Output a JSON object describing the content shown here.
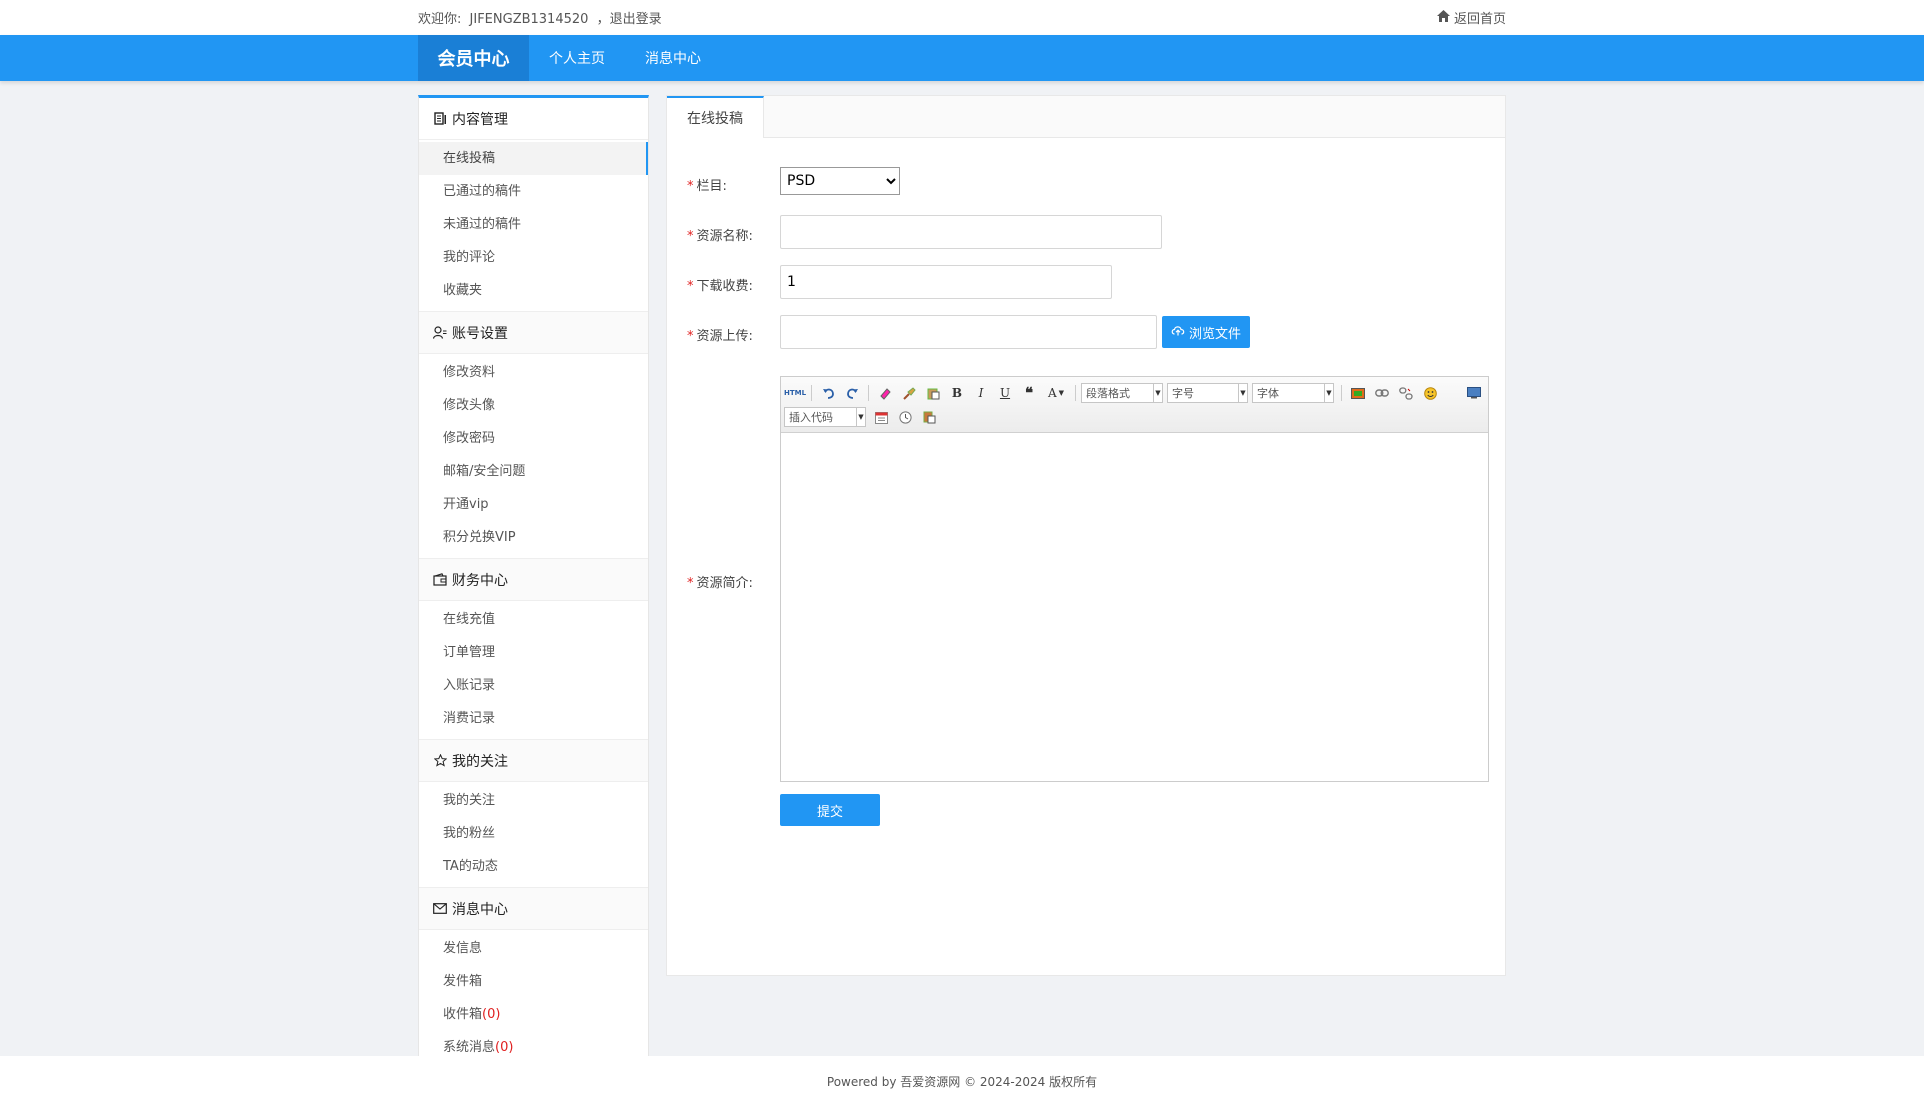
{
  "topbar": {
    "welcome_prefix": "欢迎你:",
    "username": "JIFENGZB1314520",
    "logout": "，退出登录",
    "home_link": "返回首页"
  },
  "nav": {
    "brand": "会员中心",
    "links": [
      "个人主页",
      "消息中心"
    ]
  },
  "sidebar": {
    "groups": [
      {
        "title": "内容管理",
        "icon": "document-icon",
        "items": [
          "在线投稿",
          "已通过的稿件",
          "未通过的稿件",
          "我的评论",
          "收藏夹"
        ]
      },
      {
        "title": "账号设置",
        "icon": "user-settings-icon",
        "items": [
          "修改资料",
          "修改头像",
          "修改密码",
          "邮箱/安全问题",
          "开通vip",
          "积分兑换VIP"
        ]
      },
      {
        "title": "财务中心",
        "icon": "wallet-icon",
        "items": [
          "在线充值",
          "订单管理",
          "入账记录",
          "消费记录"
        ]
      },
      {
        "title": "我的关注",
        "icon": "star-icon",
        "items": [
          "我的关注",
          "我的粉丝",
          "TA的动态"
        ]
      },
      {
        "title": "消息中心",
        "icon": "envelope-icon",
        "items": [
          "发信息",
          "发件箱",
          "收件箱",
          "系统消息"
        ],
        "counts": {
          "inbox": "(0)",
          "system": "(0)"
        }
      }
    ]
  },
  "main": {
    "tab": "在线投稿",
    "form": {
      "column_label": "栏目:",
      "column_value": "PSD",
      "name_label": "资源名称:",
      "name_value": "",
      "fee_label": "下载收费:",
      "fee_value": "1",
      "upload_label": "资源上传:",
      "upload_value": "",
      "browse_button": "浏览文件",
      "intro_label": "资源简介:",
      "submit": "提交"
    },
    "editor": {
      "html_btn": "HTML",
      "combos": [
        "段落格式",
        "字号",
        "字体",
        "插入代码"
      ]
    }
  },
  "footer": {
    "text": "Powered by 吾爱资源网 © 2024-2024 版权所有"
  },
  "colors": {
    "primary": "#2196f3",
    "required": "#e02020"
  }
}
